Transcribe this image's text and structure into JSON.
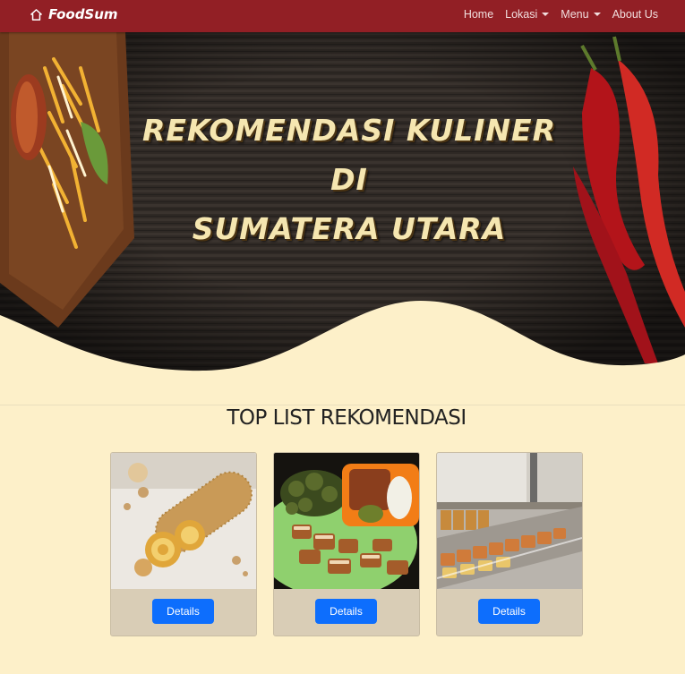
{
  "brand": {
    "name": "FoodSum",
    "icon": "home-icon"
  },
  "nav": {
    "items": [
      {
        "label": "Home",
        "dropdown": false
      },
      {
        "label": "Lokasi",
        "dropdown": true
      },
      {
        "label": "Menu",
        "dropdown": true
      },
      {
        "label": "About Us",
        "dropdown": false
      }
    ]
  },
  "hero": {
    "lines": [
      "REKOMENDASI KULINER",
      "DI",
      "SUMATERA UTARA"
    ]
  },
  "section": {
    "title": "TOP LIST REKOMENDASI",
    "cards": [
      {
        "image": "bolu-roll-cake-photo",
        "button": "Details"
      },
      {
        "image": "roast-pork-plate-photo",
        "button": "Details"
      },
      {
        "image": "bakery-display-case-photo",
        "button": "Details"
      }
    ]
  },
  "colors": {
    "navbar": "#921f25",
    "page_background": "#fdf0c9",
    "card_footer": "#d9cdb6",
    "button": "#0d6efd",
    "hero_text": "#f5e6b0"
  }
}
